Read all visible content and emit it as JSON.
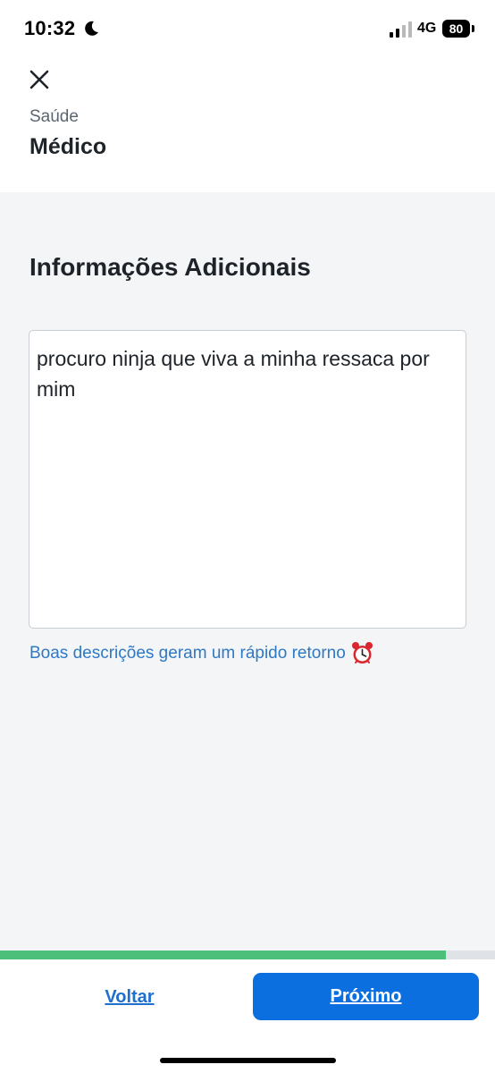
{
  "status_bar": {
    "time": "10:32",
    "network": "4G",
    "battery": "80"
  },
  "header": {
    "close_icon": "close-icon",
    "category": "Saúde",
    "service": "Médico"
  },
  "main": {
    "section_title": "Informações Adicionais",
    "description_value": "procuro ninja que viva a minha ressaca por mim",
    "hint": "Boas descrições geram um rápido retorno",
    "hint_icon": "alarm-clock-icon"
  },
  "progress": {
    "fraction": 0.9
  },
  "footer": {
    "back_label": "Voltar",
    "next_label": "Próximo"
  },
  "colors": {
    "accent": "#0b6fe0",
    "progress": "#4cc07a",
    "hint": "#2f78c4"
  }
}
